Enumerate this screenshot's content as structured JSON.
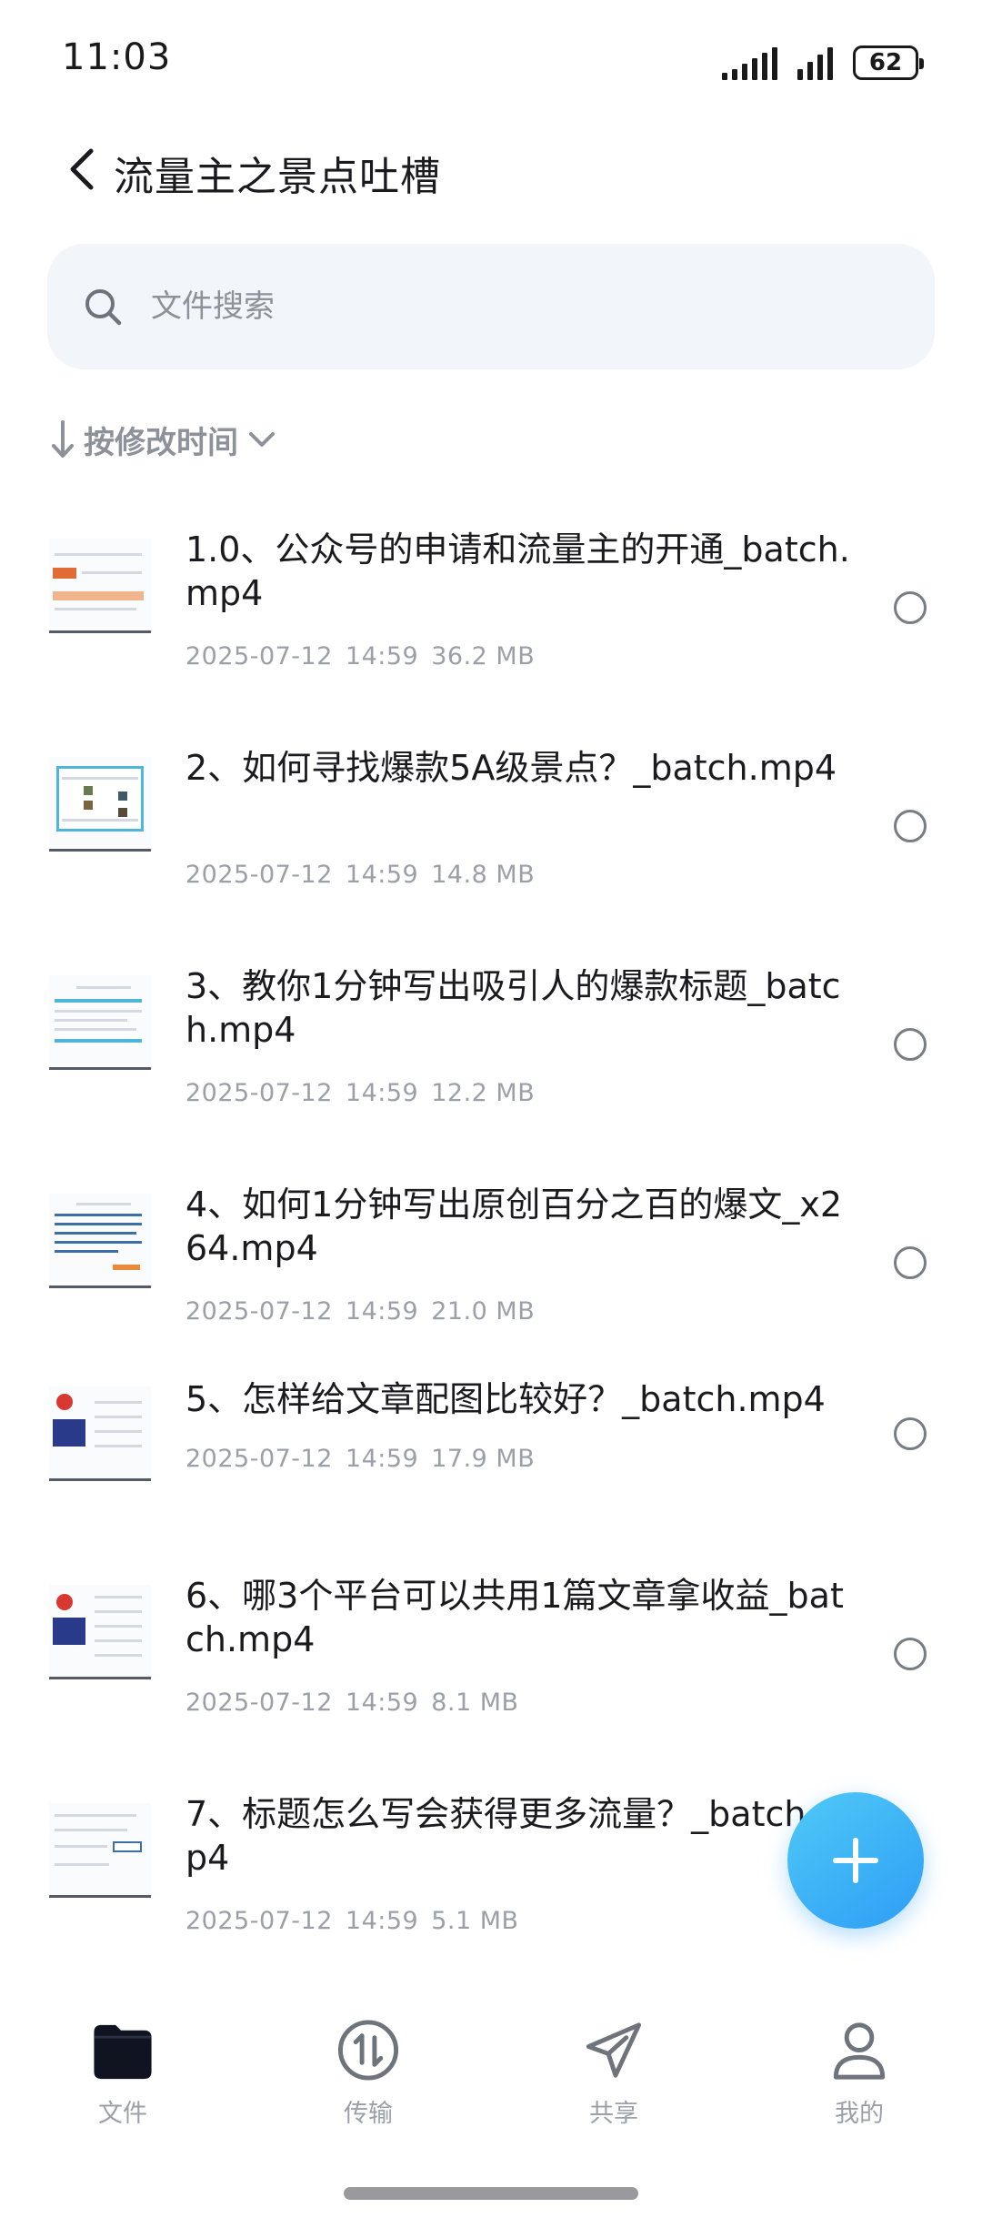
{
  "status_bar": {
    "time": "11:03",
    "battery": "62"
  },
  "header": {
    "title": "流量主之景点吐槽"
  },
  "search": {
    "placeholder": "文件搜索",
    "value": ""
  },
  "sort": {
    "label": "按修改时间"
  },
  "files": [
    {
      "name": "1.0、公众号的申请和流量主的开通_batch.mp4",
      "date": "2025-07-12",
      "time": "14:59",
      "size": "36.2 MB"
    },
    {
      "name": "2、如何寻找爆款5A级景点？_batch.mp4",
      "date": "2025-07-12",
      "time": "14:59",
      "size": "14.8 MB"
    },
    {
      "name": "3、教你1分钟写出吸引人的爆款标题_batch.mp4",
      "date": "2025-07-12",
      "time": "14:59",
      "size": "12.2 MB"
    },
    {
      "name": "4、如何1分钟写出原创百分之百的爆文_x264.mp4",
      "date": "2025-07-12",
      "time": "14:59",
      "size": "21.0 MB"
    },
    {
      "name": "5、怎样给文章配图比较好？_batch.mp4",
      "date": "2025-07-12",
      "time": "14:59",
      "size": "17.9 MB"
    },
    {
      "name": "6、哪3个平台可以共用1篇文章拿收益_batch.mp4",
      "date": "2025-07-12",
      "time": "14:59",
      "size": "8.1 MB"
    },
    {
      "name": "7、标题怎么写会获得更多流量？_batch.mp4",
      "date": "2025-07-12",
      "time": "14:59",
      "size": "5.1 MB"
    }
  ],
  "nav": {
    "items": [
      {
        "label": "文件",
        "icon": "folder-icon",
        "active": true
      },
      {
        "label": "传输",
        "icon": "transfer-icon",
        "active": false
      },
      {
        "label": "共享",
        "icon": "share-icon",
        "active": false
      },
      {
        "label": "我的",
        "icon": "profile-icon",
        "active": false
      }
    ]
  },
  "colors": {
    "fab_gradient_start": "#4fcaf7",
    "fab_gradient_end": "#2e9df5",
    "text_primary": "#1b1b1f",
    "text_secondary": "#9ba0a8"
  }
}
